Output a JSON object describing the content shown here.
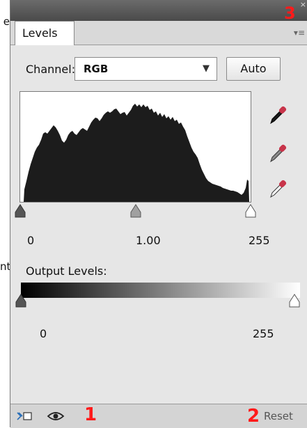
{
  "stray_text": {
    "top": "e",
    "middle": "nt"
  },
  "annotations": {
    "one": "1",
    "two": "2",
    "three": "3"
  },
  "titlebar": {
    "close_glyph": "×"
  },
  "panel": {
    "tab_label": "Levels",
    "menu_glyph": "▾≡"
  },
  "channel": {
    "label": "Channel:",
    "value": "RGB",
    "caret": "▼"
  },
  "auto_button": "Auto",
  "input_levels": {
    "black": "0",
    "gamma": "1.00",
    "white": "255"
  },
  "output": {
    "label": "Output Levels:",
    "black": "0",
    "white": "255"
  },
  "footer": {
    "reset_label": "Reset"
  },
  "colors": {
    "panel_bg": "#e6e6e6",
    "histogram_fill": "#1c1c1c",
    "annotation_red": "#ff1a1a",
    "eyedropper_tip": "#c8344a"
  }
}
